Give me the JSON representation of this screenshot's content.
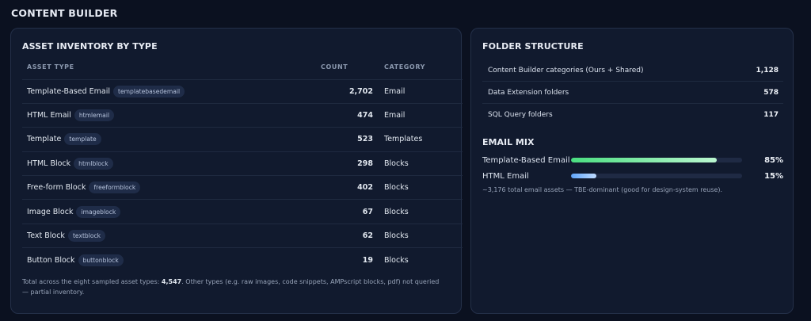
{
  "page": {
    "title": "CONTENT BUILDER"
  },
  "inventory": {
    "title": "ASSET INVENTORY BY TYPE",
    "columns": {
      "type": "ASSET TYPE",
      "count": "COUNT",
      "category": "CATEGORY"
    },
    "rows": [
      {
        "name": "Template-Based Email",
        "tag": "templatebasedemail",
        "count": "2,702",
        "category": "Email"
      },
      {
        "name": "HTML Email",
        "tag": "htmlemail",
        "count": "474",
        "category": "Email"
      },
      {
        "name": "Template",
        "tag": "template",
        "count": "523",
        "category": "Templates"
      },
      {
        "name": "HTML Block",
        "tag": "htmlblock",
        "count": "298",
        "category": "Blocks"
      },
      {
        "name": "Free-form Block",
        "tag": "freeformblock",
        "count": "402",
        "category": "Blocks"
      },
      {
        "name": "Image Block",
        "tag": "imageblock",
        "count": "67",
        "category": "Blocks"
      },
      {
        "name": "Text Block",
        "tag": "textblock",
        "count": "62",
        "category": "Blocks"
      },
      {
        "name": "Button Block",
        "tag": "buttonblock",
        "count": "19",
        "category": "Blocks"
      }
    ],
    "note": {
      "prefix": "Total across the eight sampled asset types: ",
      "total": "4,547",
      "suffix": ". Other types (e.g. raw images, code snippets, AMPscript blocks, pdf) not queried — partial inventory."
    }
  },
  "folders": {
    "title": "FOLDER STRUCTURE",
    "rows": [
      {
        "label": "Content Builder categories (Ours + Shared)",
        "value": "1,128"
      },
      {
        "label": "Data Extension folders",
        "value": "578"
      },
      {
        "label": "SQL Query folders",
        "value": "117"
      }
    ]
  },
  "email_mix": {
    "title": "EMAIL MIX",
    "rows": [
      {
        "label": "Template-Based Email",
        "percent": 85,
        "display": "85%",
        "color": "#4ade80",
        "color_end": "#bbf7d0"
      },
      {
        "label": "HTML Email",
        "percent": 15,
        "display": "15%",
        "color": "#60a5fa",
        "color_end": "#bfdbfe"
      }
    ],
    "note": "~3,176 total email assets — TBE-dominant (good for design-system reuse)."
  }
}
